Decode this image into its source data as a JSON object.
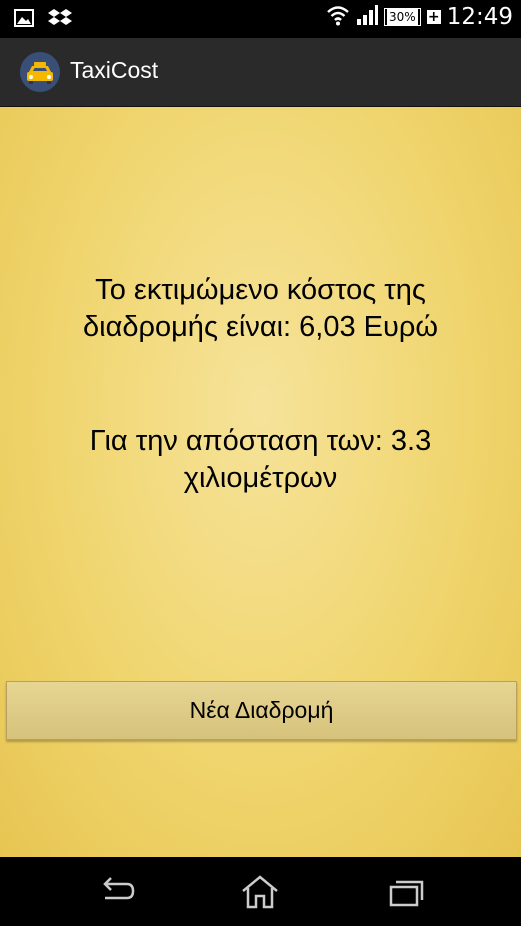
{
  "status_bar": {
    "time": "12:49",
    "battery_percent": "30%",
    "icons": [
      "gallery-icon",
      "dropbox-icon",
      "wifi-icon",
      "signal-icon",
      "battery-icon",
      "charging-icon"
    ]
  },
  "action_bar": {
    "title": "TaxiCost",
    "icon": "taxi-icon"
  },
  "main": {
    "cost_text": "Το εκτιμώμενο κόστος της διαδρομής είναι: 6,03  Ευρώ",
    "distance_text": "Για την απόσταση των: 3.3 χιλιομέτρων",
    "new_route_label": "Νέα Διαδρομή"
  },
  "nav_bar": {
    "icons": [
      "back-icon",
      "home-icon",
      "recent-apps-icon"
    ]
  },
  "colors": {
    "background": "#f0d56e",
    "action_bar": "#2a2a2a",
    "button": "#dccb85"
  }
}
